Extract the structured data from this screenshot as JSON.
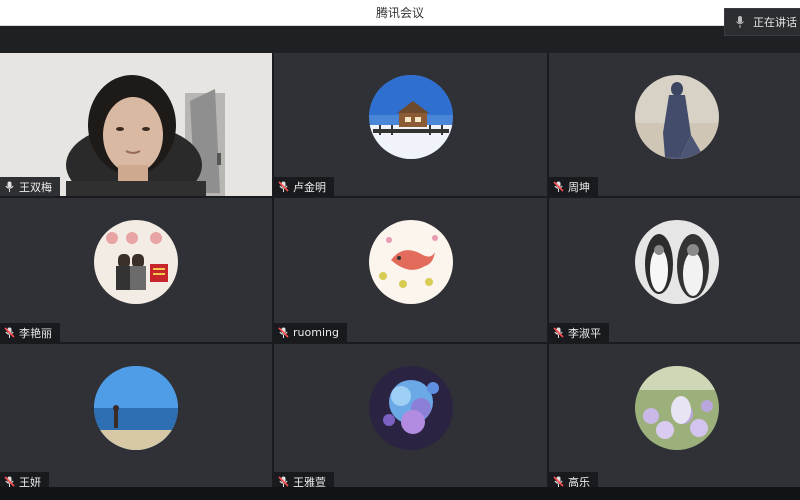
{
  "window": {
    "title": "腾讯会议"
  },
  "speaking_indicator": {
    "label": "正在讲话"
  },
  "participants": [
    {
      "name": "王双梅",
      "video": true,
      "mic": "on"
    },
    {
      "name": "卢金明",
      "video": false,
      "mic": "muted",
      "avatar": "snowy-cabin"
    },
    {
      "name": "周坤",
      "video": false,
      "mic": "muted",
      "avatar": "shadow-figure"
    },
    {
      "name": "李艳丽",
      "video": false,
      "mic": "muted",
      "avatar": "couple-cartoon"
    },
    {
      "name": "ruoming",
      "video": false,
      "mic": "muted",
      "avatar": "fish-illustration"
    },
    {
      "name": "李淑平",
      "video": false,
      "mic": "muted",
      "avatar": "penguins"
    },
    {
      "name": "王妍",
      "video": false,
      "mic": "muted",
      "avatar": "beach-person"
    },
    {
      "name": "王雅萱",
      "video": false,
      "mic": "muted",
      "avatar": "blue-flowers"
    },
    {
      "name": "高乐",
      "video": false,
      "mic": "muted",
      "avatar": "flower-field"
    }
  ],
  "colors": {
    "active_border": "#17b35b",
    "tile_bg": "#2f3136",
    "muted_icon": "#ff4d4f"
  }
}
